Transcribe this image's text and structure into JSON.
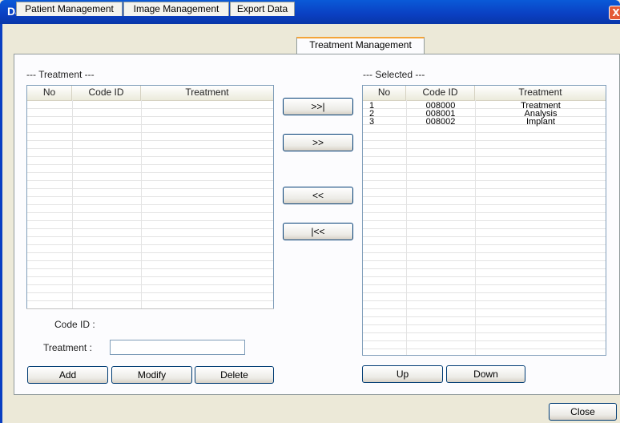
{
  "window": {
    "title": "Database",
    "close_glyph": "X"
  },
  "tabs": [
    {
      "label": "Patient Management"
    },
    {
      "label": "Image Management"
    },
    {
      "label": "Export Data"
    },
    {
      "label": "Treatment Management"
    }
  ],
  "active_tab": "Treatment Management",
  "left": {
    "group_label": "--- Treatment ---",
    "columns": [
      "No",
      "Code ID",
      "Treatment"
    ],
    "rows": [],
    "form": {
      "code_id_label": "Code ID :",
      "code_id_value": "",
      "treatment_label": "Treatment :",
      "treatment_value": ""
    },
    "buttons": {
      "add": "Add",
      "modify": "Modify",
      "delete": "Delete"
    }
  },
  "transfer_buttons": {
    "add_all": ">>|",
    "add": ">>",
    "remove": "<<",
    "remove_all": "|<<"
  },
  "right": {
    "group_label": "--- Selected ---",
    "columns": [
      "No",
      "Code ID",
      "Treatment"
    ],
    "rows": [
      {
        "no": "1",
        "code": "008000",
        "treatment": "Treatment"
      },
      {
        "no": "2",
        "code": "008001",
        "treatment": "Analysis"
      },
      {
        "no": "3",
        "code": "008002",
        "treatment": "Implant"
      }
    ],
    "buttons": {
      "up": "Up",
      "down": "Down"
    }
  },
  "footer": {
    "close_label": "Close"
  }
}
